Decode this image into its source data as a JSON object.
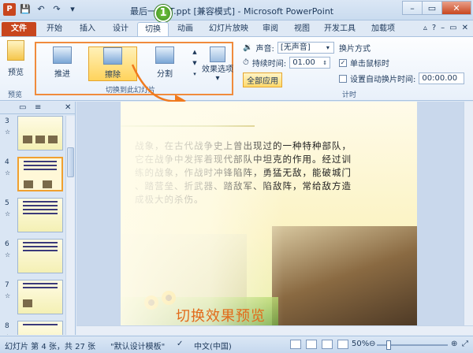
{
  "window": {
    "title": "最后一        PPT.ppt [兼容模式] - Microsoft PowerPoint",
    "badge": "1"
  },
  "tabs": [
    "文件",
    "开始",
    "插入",
    "设计",
    "切换",
    "动画",
    "幻灯片放映",
    "审阅",
    "视图",
    "开发工具",
    "加载项"
  ],
  "ribbon": {
    "preview_label": "预览",
    "preview_group": "预览",
    "transitions": [
      {
        "label": "推进"
      },
      {
        "label": "擦除"
      },
      {
        "label": "分割"
      }
    ],
    "effect_options": "效果选项",
    "gallery_group": "切换到此幻灯片",
    "sound_label": "声音:",
    "sound_value": "[无声音]",
    "duration_label": "持续时间:",
    "duration_value": "01.00",
    "apply_all": "全部应用",
    "advance_label": "换片方式",
    "on_click": "单击鼠标时",
    "auto_after": "设置自动换片时间:",
    "auto_time": "00:00.00",
    "timing_group": "计时"
  },
  "thumbnails": [
    {
      "num": "3"
    },
    {
      "num": "4"
    },
    {
      "num": "5"
    },
    {
      "num": "6"
    },
    {
      "num": "7"
    },
    {
      "num": "8"
    }
  ],
  "slide": {
    "lines": [
      "战象，在古代战争史上曾出现过的一种特种部队，",
      "它在战争中发挥着现代部队中坦克的作用。经过训",
      "练的战象，作战时冲锋陷阵，勇猛无敌，能破城门",
      "、踏营垒、折武器、踏敌军、陷敌阵，常给敌方造",
      "成极大的杀伤。"
    ],
    "caption": "切换效果预览"
  },
  "status": {
    "slide_info": "幻灯片 第 4 张，共 27 张",
    "theme": "\"默认设计模板\"",
    "language": "中文(中国)",
    "zoom": "50%"
  }
}
